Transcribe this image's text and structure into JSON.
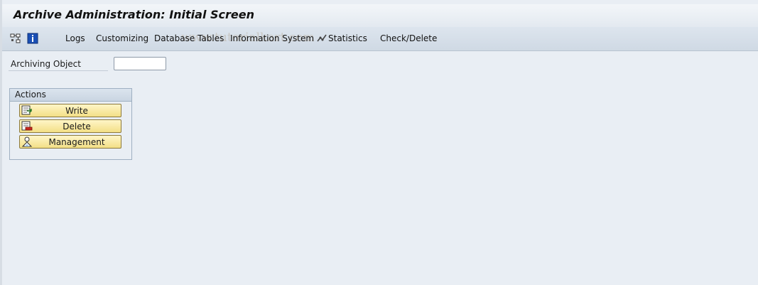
{
  "window": {
    "title": "Archive Administration: Initial Screen"
  },
  "toolbar": {
    "icons": [
      "hierarchy-icon",
      "info-icon"
    ],
    "menu": [
      {
        "label": "Logs"
      },
      {
        "label": "Customizing"
      },
      {
        "label": "Database Tables"
      },
      {
        "label": "Information System"
      },
      {
        "label": "Statistics",
        "icon": "statistics-icon"
      },
      {
        "label": "Check/Delete"
      }
    ],
    "watermark": "www.tutorialkart.com"
  },
  "form": {
    "archiving_object_label": "Archiving Object",
    "archiving_object_value": ""
  },
  "actions": {
    "title": "Actions",
    "buttons": [
      {
        "label": "Write",
        "icon": "write-icon"
      },
      {
        "label": "Delete",
        "icon": "delete-icon"
      },
      {
        "label": "Management",
        "icon": "management-icon"
      }
    ]
  },
  "colors": {
    "background": "#e9eef4",
    "button_fill": "#f7e7a0",
    "button_border": "#8d7a3c",
    "info_icon_blue": "#1a4fb5"
  }
}
